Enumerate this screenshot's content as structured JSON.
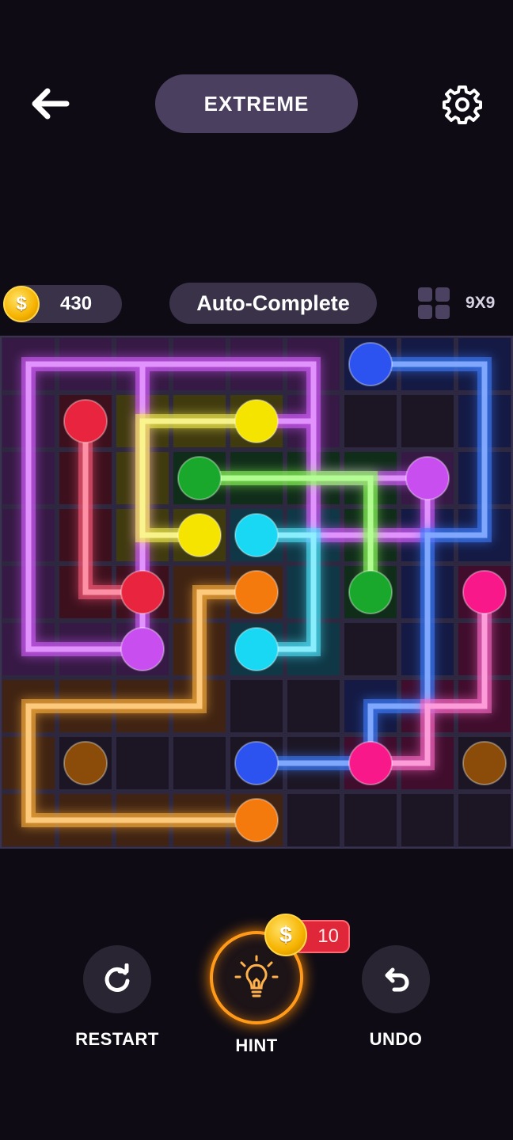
{
  "header": {
    "back_icon": "arrow-left-icon",
    "level_label": "EXTREME",
    "settings_icon": "gear-icon"
  },
  "stats": {
    "coin_symbol": "$",
    "coins": "430",
    "auto_complete_label": "Auto-Complete",
    "grid_icon": "grid-icon",
    "grid_size": "9X9"
  },
  "board": {
    "rows": 9,
    "cols": 9,
    "colors": {
      "purple": "#c84ef0",
      "blue": "#2c52f0",
      "red": "#e8243e",
      "yellow": "#f4e400",
      "green": "#1aa82c",
      "cyan": "#18d8f4",
      "orange": "#f57a0e",
      "pink": "#f8188a",
      "brown": "#8a4c08"
    },
    "glow": {
      "purple": "#d65cff",
      "blue": "#3d7cff",
      "red": "#ff5a7a",
      "yellow": "#f6f050",
      "green": "#8cff5a",
      "cyan": "#50e8ff",
      "orange": "#ffb03a",
      "pink": "#ff6ac8"
    },
    "paths": [
      {
        "color": "purple",
        "cells": [
          [
            4,
            1
          ],
          [
            5,
            1
          ],
          [
            5,
            2
          ],
          [
            7,
            2
          ],
          [
            7,
            3
          ],
          [
            5,
            3
          ],
          [
            5,
            0
          ],
          [
            0,
            0
          ],
          [
            0,
            5
          ],
          [
            2,
            5
          ],
          [
            2,
            0
          ]
        ]
      },
      {
        "color": "blue",
        "cells": [
          [
            6,
            0
          ],
          [
            8,
            0
          ],
          [
            8,
            3
          ],
          [
            7,
            3
          ],
          [
            7,
            6
          ],
          [
            6,
            6
          ],
          [
            6,
            7
          ],
          [
            4,
            7
          ]
        ]
      },
      {
        "color": "red",
        "cells": [
          [
            1,
            1
          ],
          [
            1,
            4
          ],
          [
            2,
            4
          ]
        ]
      },
      {
        "color": "yellow",
        "cells": [
          [
            4,
            1
          ],
          [
            2,
            1
          ],
          [
            2,
            3
          ],
          [
            3,
            3
          ]
        ]
      },
      {
        "color": "green",
        "cells": [
          [
            3,
            2
          ],
          [
            6,
            2
          ],
          [
            6,
            4
          ]
        ]
      },
      {
        "color": "cyan",
        "cells": [
          [
            4,
            3
          ],
          [
            5,
            3
          ],
          [
            5,
            5
          ],
          [
            4,
            5
          ]
        ]
      },
      {
        "color": "orange",
        "cells": [
          [
            4,
            4
          ],
          [
            3,
            4
          ],
          [
            3,
            6
          ],
          [
            0,
            6
          ],
          [
            0,
            8
          ],
          [
            4,
            8
          ]
        ]
      },
      {
        "color": "pink",
        "cells": [
          [
            8,
            4
          ],
          [
            8,
            6
          ],
          [
            7,
            6
          ],
          [
            7,
            7
          ],
          [
            6,
            7
          ]
        ]
      }
    ],
    "empty_cells": [
      [
        2,
        7
      ],
      [
        3,
        7
      ],
      [
        4,
        7
      ],
      [
        5,
        7
      ],
      [
        5,
        8
      ],
      [
        6,
        8
      ],
      [
        7,
        8
      ],
      [
        8,
        8
      ]
    ],
    "dots": [
      {
        "color": "blue",
        "cell": [
          6,
          0
        ]
      },
      {
        "color": "blue",
        "cell": [
          4,
          7
        ]
      },
      {
        "color": "red",
        "cell": [
          1,
          1
        ]
      },
      {
        "color": "red",
        "cell": [
          2,
          4
        ]
      },
      {
        "color": "yellow",
        "cell": [
          4,
          1
        ]
      },
      {
        "color": "yellow",
        "cell": [
          3,
          3
        ]
      },
      {
        "color": "green",
        "cell": [
          3,
          2
        ]
      },
      {
        "color": "green",
        "cell": [
          6,
          4
        ]
      },
      {
        "color": "purple",
        "cell": [
          7,
          2
        ]
      },
      {
        "color": "purple",
        "cell": [
          2,
          5
        ]
      },
      {
        "color": "cyan",
        "cell": [
          4,
          3
        ]
      },
      {
        "color": "cyan",
        "cell": [
          4,
          5
        ]
      },
      {
        "color": "orange",
        "cell": [
          4,
          4
        ]
      },
      {
        "color": "orange",
        "cell": [
          4,
          8
        ]
      },
      {
        "color": "pink",
        "cell": [
          8,
          4
        ]
      },
      {
        "color": "pink",
        "cell": [
          6,
          7
        ]
      },
      {
        "color": "brown",
        "cell": [
          1,
          7
        ]
      },
      {
        "color": "brown",
        "cell": [
          8,
          7
        ]
      }
    ]
  },
  "controls": {
    "restart_label": "RESTART",
    "restart_icon": "restart-icon",
    "hint_label": "HINT",
    "hint_icon": "lightbulb-icon",
    "hint_cost": "10",
    "undo_label": "UNDO",
    "undo_icon": "undo-icon"
  }
}
